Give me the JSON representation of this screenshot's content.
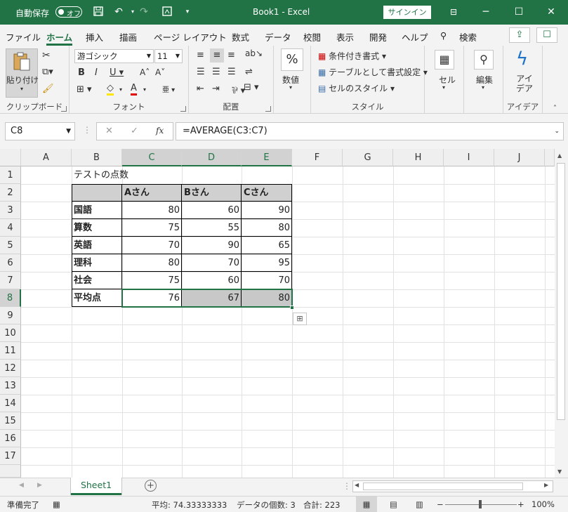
{
  "titlebar": {
    "autosave_label": "自動保存",
    "autosave_state": "オフ",
    "title": "Book1  -  Excel",
    "signin": "サインイン"
  },
  "menu": {
    "tabs": [
      "ファイル",
      "ホーム",
      "挿入",
      "描画",
      "ページ レイアウト",
      "数式",
      "データ",
      "校閲",
      "表示",
      "開発",
      "ヘルプ"
    ],
    "active_tab": "ホーム",
    "search_label": "検索"
  },
  "ribbon": {
    "clipboard": {
      "paste": "貼り付け",
      "label": "クリップボード"
    },
    "font": {
      "name": "游ゴシック",
      "size": "11",
      "label": "フォント"
    },
    "alignment": {
      "label": "配置"
    },
    "number": {
      "format": "数値",
      "percent": "%",
      "label": ""
    },
    "styles": {
      "conditional": "条件付き書式",
      "table": "テーブルとして書式設定",
      "cell_styles": "セルのスタイル",
      "label": "スタイル"
    },
    "cells": {
      "label": "セル"
    },
    "editing": {
      "label": "編集"
    },
    "ideas": {
      "button": "アイ\nデア",
      "label": "アイデア"
    }
  },
  "formula_bar": {
    "name_box": "C8",
    "fx": "fx",
    "formula": "=AVERAGE(C3:C7)"
  },
  "columns": [
    "A",
    "B",
    "C",
    "D",
    "E",
    "F",
    "G",
    "H",
    "I",
    "J"
  ],
  "rows": [
    "1",
    "2",
    "3",
    "4",
    "5",
    "6",
    "7",
    "8",
    "9",
    "10",
    "11",
    "12",
    "13",
    "14",
    "15",
    "16",
    "17"
  ],
  "sheet": {
    "title": "テストの点数",
    "headers": [
      "Aさん",
      "Bさん",
      "Cさん"
    ],
    "table": [
      {
        "subject": "国語",
        "values": [
          "80",
          "60",
          "90"
        ]
      },
      {
        "subject": "算数",
        "values": [
          "75",
          "55",
          "80"
        ]
      },
      {
        "subject": "英語",
        "values": [
          "70",
          "90",
          "65"
        ]
      },
      {
        "subject": "理科",
        "values": [
          "80",
          "70",
          "95"
        ]
      },
      {
        "subject": "社会",
        "values": [
          "75",
          "60",
          "70"
        ]
      }
    ],
    "average_row": {
      "subject": "平均点",
      "values": [
        "76",
        "67",
        "80"
      ]
    }
  },
  "sheet_tabs": {
    "active": "Sheet1"
  },
  "status": {
    "ready": "準備完了",
    "average": "平均: 74.33333333",
    "count": "データの個数: 3",
    "sum": "合計: 223",
    "zoom": "100%"
  },
  "colors": {
    "accent": "#217346",
    "selection_fill": "#c8c8c8"
  }
}
